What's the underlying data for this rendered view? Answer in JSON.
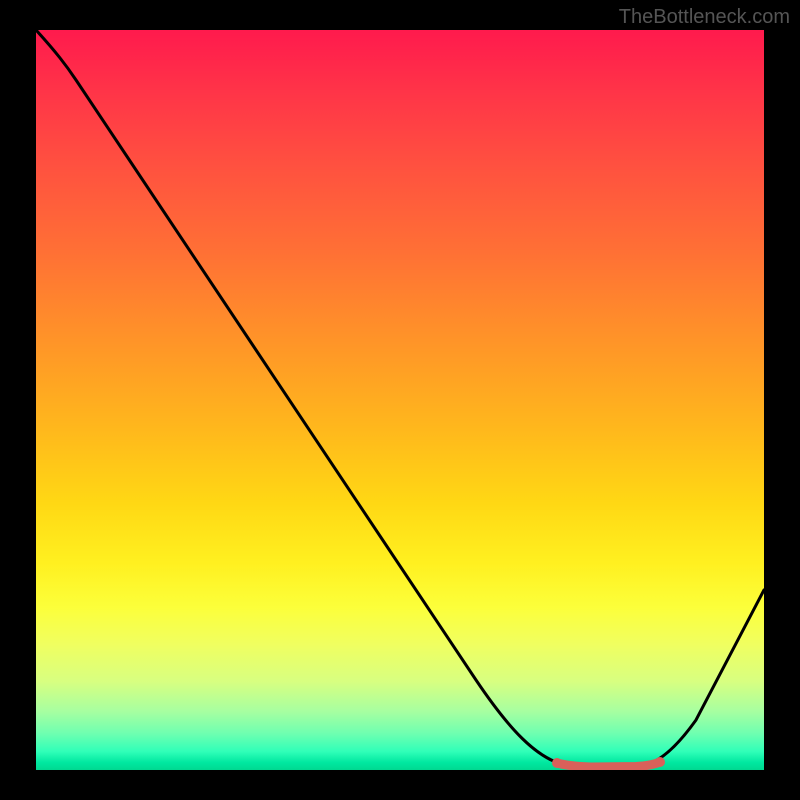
{
  "watermark": "TheBottleneck.com",
  "chart_data": {
    "type": "line",
    "title": "",
    "xlabel": "",
    "ylabel": "",
    "xlim": [
      0,
      100
    ],
    "ylim": [
      0,
      100
    ],
    "series": [
      {
        "name": "bottleneck-curve",
        "x": [
          0,
          4,
          10,
          20,
          30,
          40,
          50,
          60,
          66,
          70,
          74,
          78,
          82,
          86,
          90,
          95,
          100
        ],
        "y": [
          100,
          96,
          90,
          77,
          64,
          51,
          38,
          24,
          14,
          6,
          1,
          0,
          0,
          1,
          6,
          15,
          27
        ]
      },
      {
        "name": "highlight-flat-region",
        "x": [
          73,
          85
        ],
        "y": [
          0.5,
          0.5
        ]
      }
    ],
    "gradient_stops": [
      {
        "pos": 0,
        "color": "#ff1a4d"
      },
      {
        "pos": 0.3,
        "color": "#ff7035"
      },
      {
        "pos": 0.64,
        "color": "#ffd814"
      },
      {
        "pos": 0.88,
        "color": "#d8ff80"
      },
      {
        "pos": 1.0,
        "color": "#00d890"
      }
    ]
  }
}
